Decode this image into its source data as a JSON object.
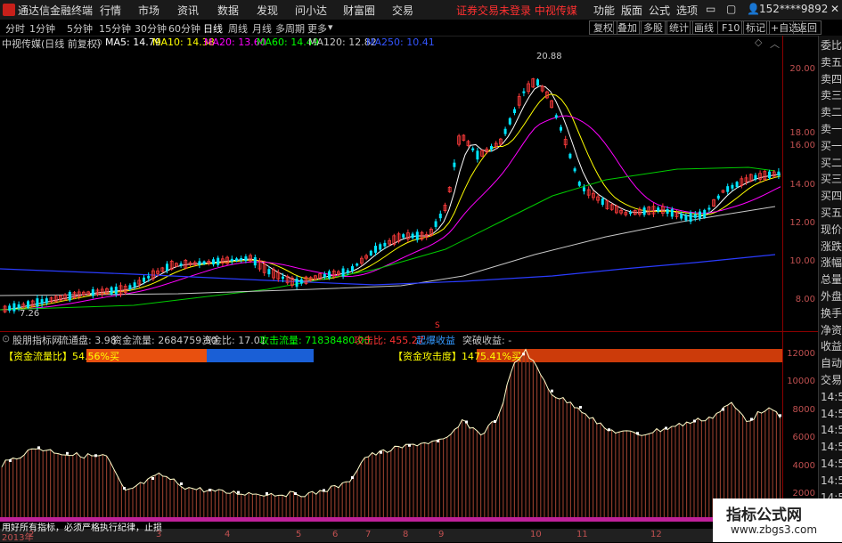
{
  "titlebar": {
    "app_name": "通达信金融终端",
    "menus": [
      "行情",
      "市场",
      "资讯",
      "数据",
      "发现",
      "问小达",
      "财富圈",
      "交易"
    ],
    "warning": "证券交易未登录  中视传媒",
    "right_menus": [
      "功能",
      "版面",
      "公式",
      "选项"
    ],
    "user": "152****9892"
  },
  "periodbar": {
    "periods": [
      "分时",
      "1分钟",
      "5分钟",
      "15分钟",
      "30分钟",
      "60分钟",
      "日线",
      "周线",
      "月线",
      "多周期",
      "更多"
    ],
    "active": "日线",
    "tools": [
      "复权",
      "叠加",
      "多股",
      "统计",
      "画线",
      "F10",
      "标记",
      "+自选",
      "返回"
    ]
  },
  "stock": {
    "name": "中视传媒(日线 前复权)",
    "ma": [
      {
        "label": "MA5: 14.79",
        "color": "#ffffff"
      },
      {
        "label": "MA10: 14.38",
        "color": "#ffff00"
      },
      {
        "label": "MA20: 13.60",
        "color": "#ff00ff"
      },
      {
        "label": "MA60: 14.49",
        "color": "#00ff00"
      },
      {
        "label": "MA120: 12.82",
        "color": "#c8c8c8"
      },
      {
        "label": "MA250: 10.41",
        "color": "#3355ff"
      }
    ],
    "high_label": "20.88",
    "low_label": "7.26",
    "marker_s": "S"
  },
  "price_axis": [
    "20.00",
    "18.00",
    "16.00",
    "14.00",
    "12.00",
    "10.00",
    "8.00"
  ],
  "right_panel": [
    "委比",
    "卖五",
    "卖四",
    "卖三",
    "卖二",
    "卖一",
    "买一",
    "买二",
    "买三",
    "买四",
    "买五",
    "现价",
    "涨跌",
    "涨幅",
    "总量",
    "外盘",
    "换手",
    "净资",
    "收益",
    "自动",
    "交易",
    "14:56",
    "14:56",
    "14:56",
    "14:56",
    "14:56",
    "14:56",
    "14:56",
    "14:56",
    "14:56"
  ],
  "indicator": {
    "name": "股朋指标网",
    "items": [
      {
        "label": "流通盘: 3.98",
        "color": "#c8c8c8"
      },
      {
        "label": "资金流量: 2684759.50",
        "color": "#c8c8c8"
      },
      {
        "label": "资金比: 17.01",
        "color": "#c8c8c8"
      },
      {
        "label": "攻击流量: 71838480.00",
        "color": "#00ff00"
      },
      {
        "label": "攻击比: 455.27",
        "color": "#ff3333"
      },
      {
        "label": "起爆收益",
        "color": "#3399ff"
      },
      {
        "label": "突破收益: -",
        "color": "#c8c8c8"
      }
    ],
    "bar1_label": "【资金流量比】54.56%买",
    "bar2_label": "【资金攻击度】1475.41%买"
  },
  "sub_axis": [
    "12000",
    "10000",
    "8000",
    "6000",
    "4000",
    "2000"
  ],
  "bottom": {
    "footer_text": "用好所有指标，必须严格执行纪律，止损",
    "year": "2013年",
    "months": [
      "2",
      "3",
      "4",
      "5",
      "6",
      "7",
      "8",
      "9",
      "10",
      "11",
      "12"
    ]
  },
  "watermark": {
    "title": "指标公式网",
    "url": "www.zbgs3.com"
  }
}
